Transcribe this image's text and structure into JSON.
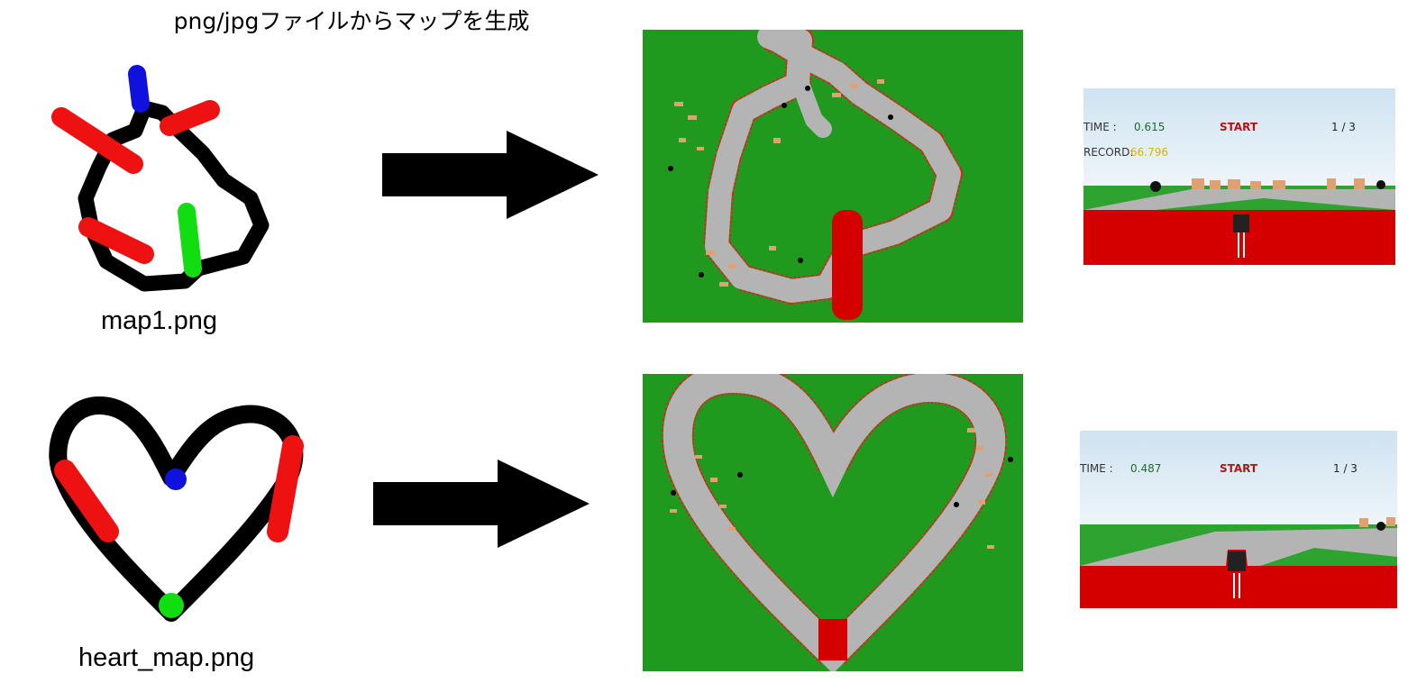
{
  "title": "png/jpgファイルからマップを生成",
  "rows": [
    {
      "caption": "map1.png",
      "hud": {
        "time_label": "TIME :",
        "time_value": "0.615",
        "status": "START",
        "lap": "1 / 3",
        "record_label": "RECORD:",
        "record_value": "66.796"
      }
    },
    {
      "caption": "heart_map.png",
      "hud": {
        "time_label": "TIME :",
        "time_value": "0.487",
        "status": "START",
        "lap": "1 / 3"
      }
    }
  ],
  "colors": {
    "grass": "#1f9a1f",
    "track": "#b4b4b4",
    "curb": "#e02020",
    "start_zone": "#d40000",
    "sketch_line": "#000000",
    "sketch_red": "#ee1111",
    "sketch_blue": "#1111dd",
    "sketch_green": "#11dd11"
  }
}
